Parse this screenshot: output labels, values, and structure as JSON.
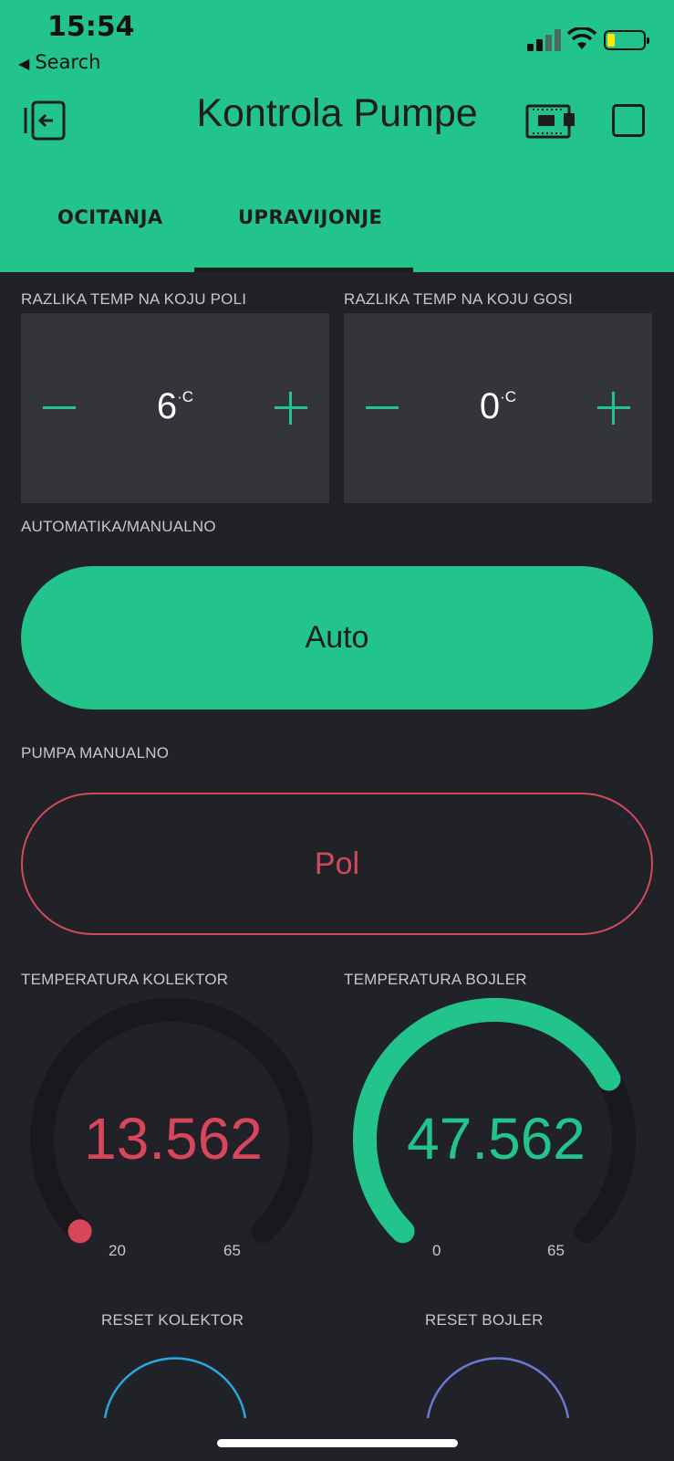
{
  "status_bar": {
    "time": "15:54",
    "back_label": "Search"
  },
  "header": {
    "title": "Kontrola Pumpe"
  },
  "tabs": [
    {
      "label": "OCITANJA",
      "active": false
    },
    {
      "label": "UPRAVIJONJE",
      "active": true
    }
  ],
  "steppers": [
    {
      "label": "RAZLIKA TEMP NA KOJU POLI",
      "value": "6",
      "unit": "·C"
    },
    {
      "label": "RAZLIKA TEMP NA KOJU GOSI",
      "value": "0",
      "unit": "·C"
    }
  ],
  "mode": {
    "label": "AUTOMATIKA/MANUALNO",
    "button_label": "Auto"
  },
  "pump": {
    "label": "PUMPA MANUALNO",
    "button_label": "Pol"
  },
  "gauges": [
    {
      "label": "TEMPERATURA KOLEKTOR",
      "value": "13.562",
      "min": "20",
      "max": "65",
      "color": "#d9465c",
      "fill_fraction": 0
    },
    {
      "label": "TEMPERATURA BOJLER",
      "value": "47.562",
      "min": "0",
      "max": "65",
      "color": "#22c48c",
      "fill_fraction": 0.73
    }
  ],
  "reset_buttons": [
    {
      "label": "RESET KOLEKTOR",
      "color": "#2aa6e0"
    },
    {
      "label": "RESET BOJLER",
      "color": "#6b79d6"
    }
  ],
  "colors": {
    "accent": "#22c48c",
    "background": "#212227",
    "tile": "#33353b",
    "alert": "#d14a5c"
  }
}
